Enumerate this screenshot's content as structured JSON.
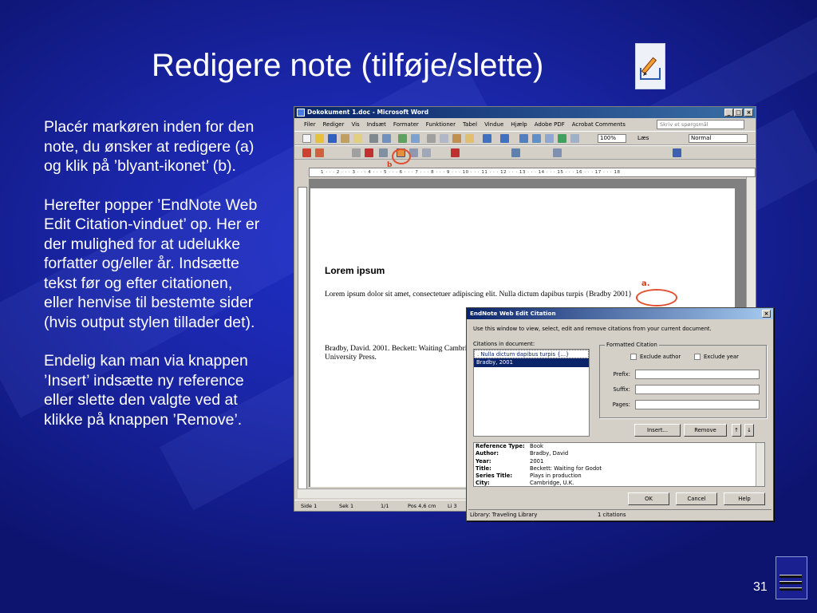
{
  "slide": {
    "title": "Redigere note (tilføje/slette)",
    "title_icon": "pencil-edit-icon",
    "paragraphs": [
      "Placér markøren inden for den note, du ønsker at redigere (a) og klik på ’blyant-ikonet’ (b).",
      "Herefter popper ’EndNote Web Edit Citation-vinduet’ op. Her er der mulighed for at udelukke forfatter og/eller år. Indsætte tekst før og efter citationen, eller henvise til bestemte sider (hvis output stylen tillader det).",
      "Endelig kan man via knappen ’Insert’ indsætte ny reference eller slette den valgte ved at klikke på knappen ’Remove’."
    ],
    "page_number": "31",
    "colors": {
      "background": "#1a26a8",
      "text": "#ffffff",
      "annotation": "#e05030"
    }
  },
  "word": {
    "window_title": "Dokokument 1.doc - Microsoft Word",
    "menu": [
      "Filer",
      "Rediger",
      "Vis",
      "Indsæt",
      "Formater",
      "Funktioner",
      "Tabel",
      "Vindue",
      "Hjælp",
      "Adobe PDF",
      "Acrobat Comments"
    ],
    "ask_placeholder": "Skriv et spørgsmål",
    "zoom": "100%",
    "read_button": "Læs",
    "style": "Normal",
    "ruler_text": "1 · · · 2 · · · 3 · · · 4 · · · 5 · · · 6 · · · 7 · · · 8 · · · 9 · · · 10 · · · 11 · · · 12 · · · 13 · · · 14 · · · 15 · · · 16 · · · 17 · · · 18",
    "doc_heading": "Lorem ipsum",
    "doc_paragraph": "Lorem ipsum dolor sit amet, consectetuer adipiscing elit. Nulla dictum dapibus turpis {Bradby 2001}",
    "doc_reference": "Bradby, David. 2001. Beckett: Waiting Cambridge University Press.",
    "label_a": "a.",
    "label_b": "b",
    "status": {
      "page": "Side 1",
      "section": "Sek 1",
      "pages": "1/1",
      "pos": "Pos 4,6 cm",
      "line": "Li 3"
    }
  },
  "dialog": {
    "title": "EndNote Web Edit Citation",
    "info": "Use this window to view, select, edit and remove citations from your current document.",
    "citations_label": "Citations in document:",
    "citations": [
      ". Nulla dictum dapibus turpis {...}",
      "Bradby, 2001"
    ],
    "formatted_label": "Formatted Citation",
    "exclude_author": "Exclude author",
    "exclude_year": "Exclude year",
    "prefix_label": "Prefix:",
    "suffix_label": "Suffix:",
    "pages_label": "Pages:",
    "insert_button": "Insert...",
    "remove_button": "Remove",
    "reference": [
      {
        "key": "Reference Type:",
        "value": "Book"
      },
      {
        "key": "Author:",
        "value": "Bradby, David"
      },
      {
        "key": "Year:",
        "value": "2001"
      },
      {
        "key": "Title:",
        "value": "Beckett: Waiting for Godot"
      },
      {
        "key": "Series Title:",
        "value": "Plays in production"
      },
      {
        "key": "City:",
        "value": "Cambridge, U.K."
      }
    ],
    "ok_button": "OK",
    "cancel_button": "Cancel",
    "help_button": "Help",
    "library": "Library: Traveling Library",
    "citation_count": "1 citations"
  }
}
